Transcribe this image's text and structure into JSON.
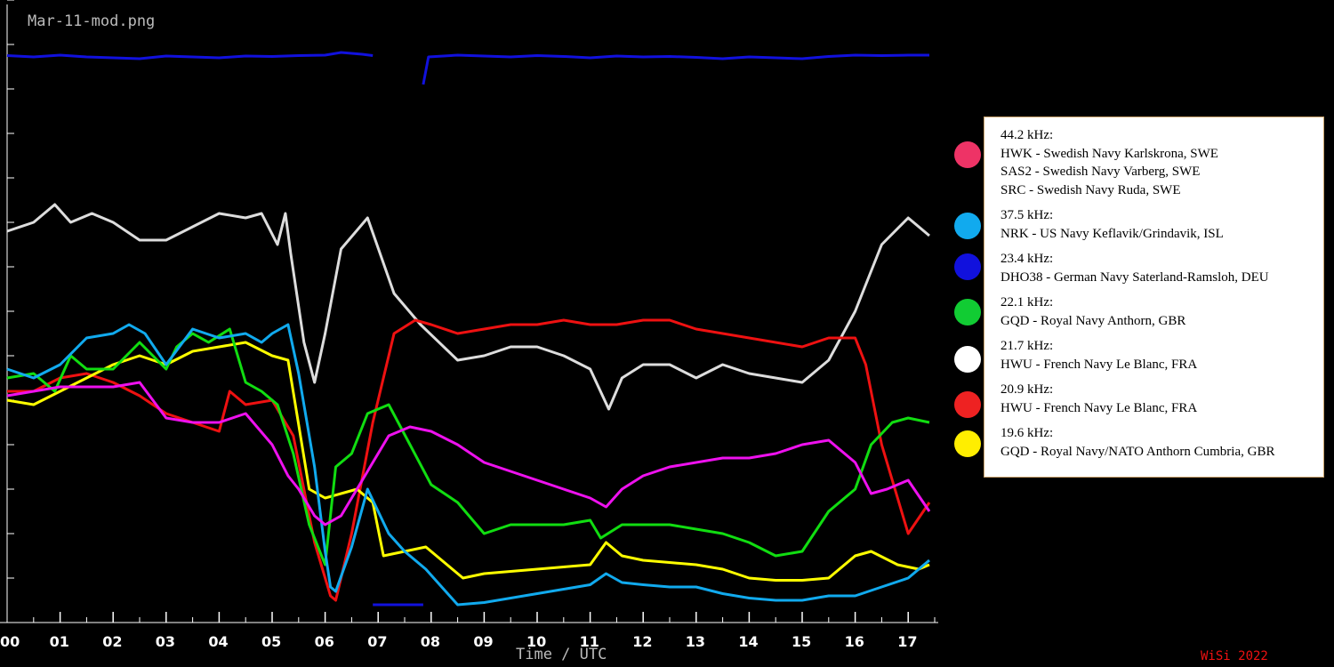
{
  "file_label": "Mar-11-mod.png",
  "signature": "WiSi 2022",
  "chart_data": {
    "type": "line",
    "xlabel": "Time / UTC",
    "ylabel": "",
    "title": "",
    "xlim": [
      0,
      17.6
    ],
    "ylim": [
      0,
      14
    ],
    "grid": false,
    "legend_position": "right",
    "x_tick_labels": [
      "00",
      "01",
      "02",
      "03",
      "04",
      "05",
      "06",
      "07",
      "08",
      "09",
      "10",
      "11",
      "12",
      "13",
      "14",
      "15",
      "16",
      "17"
    ],
    "series": [
      {
        "name": "23.4 kHz",
        "color": "#1111dd",
        "x": [
          0,
          0.5,
          1,
          1.5,
          2,
          2.5,
          3,
          3.5,
          4,
          4.5,
          5,
          5.5,
          6,
          6.3,
          6.7,
          6.9
        ],
        "y": [
          12.75,
          12.72,
          12.76,
          12.72,
          12.7,
          12.68,
          12.74,
          12.72,
          12.7,
          12.74,
          12.73,
          12.75,
          12.76,
          12.82,
          12.78,
          12.75
        ]
      },
      {
        "name": "23.4 kHz",
        "color": "#1111dd",
        "x": [
          6.9,
          7.85
        ],
        "y": [
          0.4,
          0.4
        ]
      },
      {
        "name": "23.4 kHz",
        "color": "#1111dd",
        "x": [
          7.85,
          7.95,
          8.5,
          9,
          9.5,
          10,
          10.5,
          11,
          11.5,
          12,
          12.5,
          13,
          13.5,
          14,
          14.5,
          15,
          15.5,
          16,
          16.5,
          17,
          17.4
        ],
        "y": [
          12.1,
          12.72,
          12.76,
          12.74,
          12.72,
          12.75,
          12.73,
          12.7,
          12.74,
          12.72,
          12.73,
          12.71,
          12.68,
          12.72,
          12.7,
          12.68,
          12.73,
          12.76,
          12.75,
          12.76,
          12.76
        ]
      },
      {
        "name": "21.7 kHz",
        "color": "#dddddd",
        "x": [
          0,
          0.5,
          0.9,
          1.2,
          1.6,
          2,
          2.5,
          3,
          3.5,
          4,
          4.5,
          4.8,
          5.1,
          5.25,
          5.35,
          5.6,
          5.8,
          6,
          6.3,
          6.8,
          7.3,
          7.8,
          8.5,
          9,
          9.5,
          10,
          10.5,
          11,
          11.35,
          11.6,
          12,
          12.5,
          13,
          13.5,
          14,
          14.5,
          15,
          15.5,
          16,
          16.5,
          17,
          17.4
        ],
        "y": [
          8.8,
          9.0,
          9.4,
          9.0,
          9.2,
          9.0,
          8.6,
          8.6,
          8.9,
          9.2,
          9.1,
          9.2,
          8.5,
          9.2,
          8.3,
          6.3,
          5.4,
          6.5,
          8.4,
          9.1,
          7.4,
          6.7,
          5.9,
          6.0,
          6.2,
          6.2,
          6.0,
          5.7,
          4.8,
          5.5,
          5.8,
          5.8,
          5.5,
          5.8,
          5.6,
          5.5,
          5.4,
          5.9,
          7.0,
          8.5,
          9.1,
          8.7
        ]
      },
      {
        "name": "20.9 kHz",
        "color": "#ee1111",
        "x": [
          0,
          0.5,
          1,
          1.5,
          2,
          2.5,
          3,
          3.5,
          4,
          4.2,
          4.5,
          5,
          5.4,
          5.8,
          6.1,
          6.2,
          6.5,
          6.9,
          7.3,
          7.7,
          8,
          8.5,
          9,
          9.5,
          10,
          10.5,
          11,
          11.5,
          12,
          12.5,
          13,
          13.5,
          14,
          14.5,
          15,
          15.5,
          16,
          16.2,
          16.5,
          17,
          17.4
        ],
        "y": [
          5.2,
          5.2,
          5.5,
          5.6,
          5.4,
          5.1,
          4.7,
          4.5,
          4.3,
          5.2,
          4.9,
          5.0,
          4.2,
          1.8,
          0.6,
          0.5,
          2.0,
          4.5,
          6.5,
          6.8,
          6.7,
          6.5,
          6.6,
          6.7,
          6.7,
          6.8,
          6.7,
          6.7,
          6.8,
          6.8,
          6.6,
          6.5,
          6.4,
          6.3,
          6.2,
          6.4,
          6.4,
          5.8,
          4.0,
          2.0,
          2.7
        ]
      },
      {
        "name": "19.6 kHz",
        "color": "#ffff00",
        "x": [
          0,
          0.5,
          1,
          1.5,
          2,
          2.5,
          3,
          3.5,
          4,
          4.5,
          5,
          5.3,
          5.7,
          6,
          6.3,
          6.6,
          6.9,
          7.1,
          7.5,
          7.9,
          8.3,
          8.6,
          9,
          9.5,
          10,
          10.5,
          11,
          11.3,
          11.6,
          12,
          12.5,
          13,
          13.5,
          14,
          14.5,
          15,
          15.5,
          16,
          16.3,
          16.8,
          17.2,
          17.4
        ],
        "y": [
          5.0,
          4.9,
          5.2,
          5.5,
          5.8,
          6.0,
          5.8,
          6.1,
          6.2,
          6.3,
          6.0,
          5.9,
          3.0,
          2.8,
          2.9,
          3.0,
          2.7,
          1.5,
          1.6,
          1.7,
          1.3,
          1.0,
          1.1,
          1.15,
          1.2,
          1.25,
          1.3,
          1.8,
          1.5,
          1.4,
          1.35,
          1.3,
          1.2,
          1.0,
          0.95,
          0.95,
          1.0,
          1.5,
          1.6,
          1.3,
          1.2,
          1.3
        ]
      },
      {
        "name": "22.1 kHz",
        "color": "#11dd11",
        "x": [
          0,
          0.5,
          0.9,
          1.2,
          1.5,
          2,
          2.5,
          3,
          3.2,
          3.5,
          3.8,
          4.2,
          4.5,
          4.8,
          5.1,
          5.4,
          5.7,
          6,
          6.2,
          6.5,
          6.8,
          7.2,
          7.6,
          8,
          8.5,
          9,
          9.5,
          10,
          10.5,
          11,
          11.2,
          11.6,
          12,
          12.5,
          13,
          13.5,
          14,
          14.5,
          15,
          15.5,
          16,
          16.3,
          16.7,
          17,
          17.4
        ],
        "y": [
          5.5,
          5.6,
          5.2,
          6.0,
          5.7,
          5.7,
          6.3,
          5.7,
          6.2,
          6.5,
          6.3,
          6.6,
          5.4,
          5.2,
          4.9,
          3.8,
          2.2,
          1.3,
          3.5,
          3.8,
          4.7,
          4.9,
          4.0,
          3.1,
          2.7,
          2.0,
          2.2,
          2.2,
          2.2,
          2.3,
          1.9,
          2.2,
          2.2,
          2.2,
          2.1,
          2.0,
          1.8,
          1.5,
          1.6,
          2.5,
          3.0,
          4.0,
          4.5,
          4.6,
          4.5
        ]
      },
      {
        "name": "37.5 kHz",
        "color": "#11aaee",
        "x": [
          0,
          0.5,
          1,
          1.5,
          2,
          2.3,
          2.6,
          3,
          3.5,
          4,
          4.5,
          4.8,
          5,
          5.3,
          5.5,
          5.8,
          6,
          6.1,
          6.2,
          6.5,
          6.8,
          7.2,
          7.5,
          7.9,
          8.5,
          9,
          9.5,
          10,
          10.5,
          11,
          11.3,
          11.6,
          12,
          12.5,
          13,
          13.5,
          14,
          14.5,
          15,
          15.5,
          16,
          16.5,
          17,
          17.4
        ],
        "y": [
          5.7,
          5.5,
          5.8,
          6.4,
          6.5,
          6.7,
          6.5,
          5.8,
          6.6,
          6.4,
          6.5,
          6.3,
          6.5,
          6.7,
          5.6,
          3.5,
          1.6,
          0.8,
          0.7,
          1.7,
          3.0,
          2.0,
          1.6,
          1.2,
          0.4,
          0.45,
          0.55,
          0.65,
          0.75,
          0.85,
          1.1,
          0.9,
          0.85,
          0.8,
          0.8,
          0.65,
          0.55,
          0.5,
          0.5,
          0.6,
          0.6,
          0.8,
          1.0,
          1.4
        ]
      },
      {
        "name": "44.2 kHz",
        "color": "#ee11ee",
        "x": [
          0,
          0.5,
          1,
          1.5,
          2,
          2.5,
          3,
          3.5,
          4,
          4.5,
          5,
          5.3,
          5.5,
          5.8,
          6,
          6.3,
          6.6,
          6.9,
          7.2,
          7.6,
          8,
          8.5,
          9,
          9.5,
          10,
          10.5,
          11,
          11.3,
          11.6,
          12,
          12.5,
          13,
          13.5,
          14,
          14.5,
          15,
          15.5,
          16,
          16.3,
          16.6,
          17,
          17.4
        ],
        "y": [
          5.1,
          5.2,
          5.3,
          5.3,
          5.3,
          5.4,
          4.6,
          4.5,
          4.5,
          4.7,
          4.0,
          3.3,
          3.0,
          2.4,
          2.2,
          2.4,
          3.0,
          3.6,
          4.2,
          4.4,
          4.3,
          4.0,
          3.6,
          3.4,
          3.2,
          3.0,
          2.8,
          2.6,
          3.0,
          3.3,
          3.5,
          3.6,
          3.7,
          3.7,
          3.8,
          4.0,
          4.1,
          3.6,
          2.9,
          3.0,
          3.2,
          2.5
        ]
      }
    ]
  },
  "legend": {
    "entries": [
      {
        "color": "#ee3366",
        "lines": [
          "44.2 kHz:",
          "HWK - Swedish Navy Karlskrona, SWE",
          "SAS2 - Swedish Navy Varberg, SWE",
          "SRC - Swedish Navy Ruda, SWE"
        ]
      },
      {
        "color": "#11aaee",
        "lines": [
          "37.5 kHz:",
          "NRK - US Navy Keflavik/Grindavik, ISL"
        ]
      },
      {
        "color": "#1111dd",
        "lines": [
          "23.4 kHz:",
          "DHO38 - German Navy Saterland-Ramsloh, DEU"
        ]
      },
      {
        "color": "#11cc33",
        "lines": [
          "22.1 kHz:",
          "GQD - Royal Navy Anthorn, GBR"
        ]
      },
      {
        "color": "#ffffff",
        "lines": [
          "21.7 kHz:",
          "HWU - French Navy Le Blanc, FRA"
        ]
      },
      {
        "color": "#ee2222",
        "lines": [
          "20.9 kHz:",
          "HWU - French Navy Le Blanc, FRA"
        ]
      },
      {
        "color": "#ffee00",
        "lines": [
          "19.6 kHz:",
          "GQD - Royal Navy/NATO Anthorn Cumbria, GBR"
        ]
      }
    ]
  }
}
